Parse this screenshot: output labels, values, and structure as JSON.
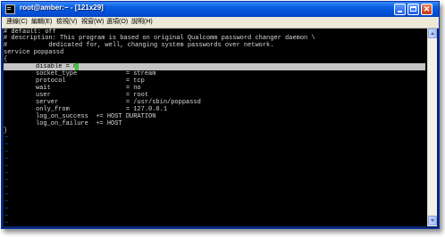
{
  "window": {
    "title": "root@amber:~ - [121x29]"
  },
  "menu": [
    "連線(C)",
    "編輯(E)",
    "檢視(V)",
    "視窗(W)",
    "選項(O)",
    "說明(H)"
  ],
  "terminal": {
    "header_lines": [
      "# default: off",
      "# description: This program is based on original Qualcomm password changer daemon \\",
      "#           dedicated for, well, changing system passwords over network.",
      "service poppassd",
      "{"
    ],
    "highlighted_line": "disable = n",
    "config_lines": [
      "socket_type             = stream",
      "protocol                = tcp",
      "wait                    = no",
      "user                    = root",
      "server                  = /usr/sbin/poppassd",
      "only_from               = 127.0.0.1",
      "log_on_success  += HOST DURATION",
      "log_on_failure  += HOST"
    ],
    "closing_line": "}",
    "empty_marker": "~",
    "colors": {
      "background": "#000000",
      "text": "#d8d8d8",
      "highlight": "#c4c4c4",
      "cursor": "#3cc23c",
      "tilde": "#2a5bd7"
    }
  }
}
